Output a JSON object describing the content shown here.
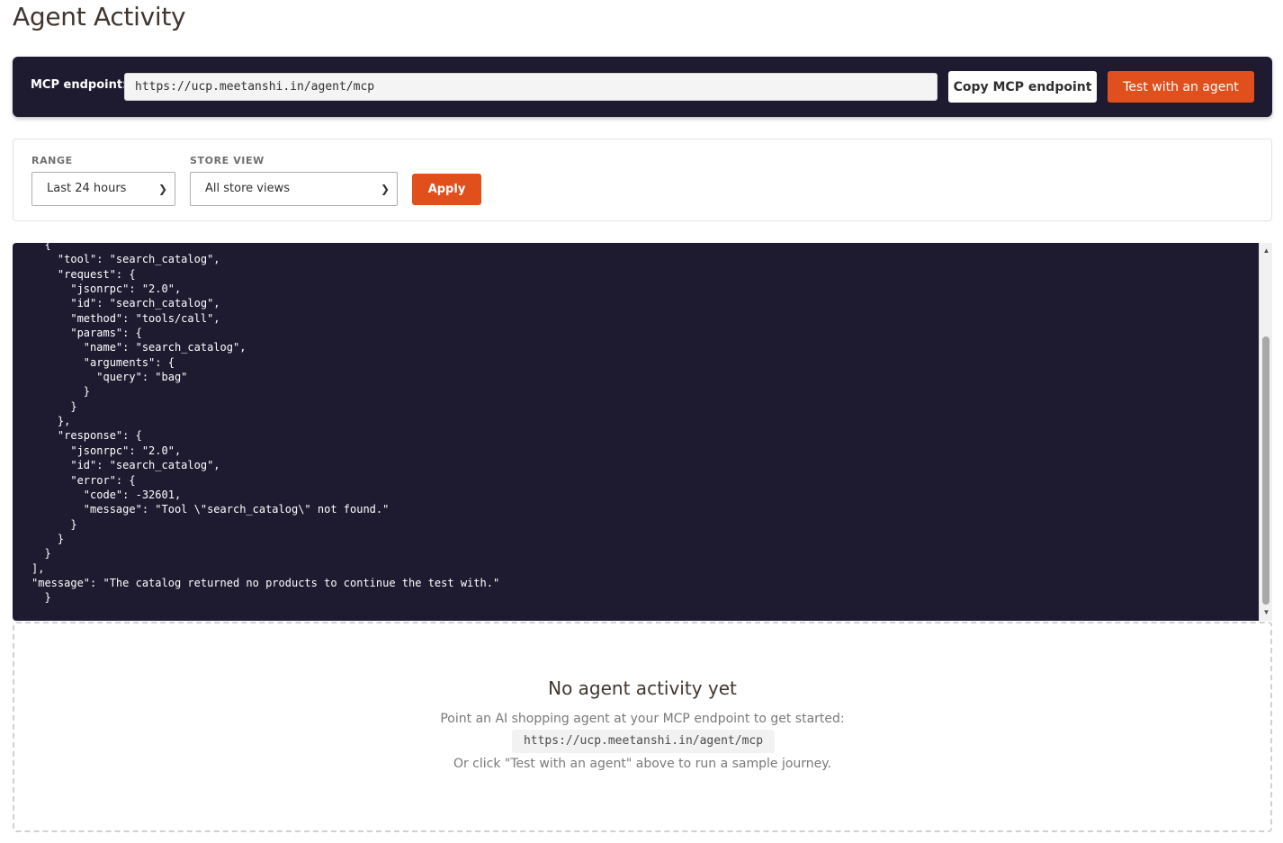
{
  "page": {
    "title": "Agent Activity"
  },
  "endpoint_bar": {
    "label": "MCP endpoint:",
    "url": "https://ucp.meetanshi.in/agent/mcp",
    "copy_label": "Copy MCP endpoint",
    "test_label": "Test with an agent"
  },
  "filters": {
    "range_label": "RANGE",
    "range_value": "Last 24 hours",
    "store_view_label": "STORE VIEW",
    "store_view_value": "All store views",
    "apply_label": "Apply"
  },
  "log": {
    "lines": [
      "      {",
      "        \"tool\": \"search_catalog\",",
      "        \"request\": {",
      "          \"jsonrpc\": \"2.0\",",
      "          \"id\": \"search_catalog\",",
      "          \"method\": \"tools/call\",",
      "          \"params\": {",
      "            \"name\": \"search_catalog\",",
      "            \"arguments\": {",
      "              \"query\": \"bag\"",
      "            }",
      "          }",
      "        },",
      "        \"response\": {",
      "          \"jsonrpc\": \"2.0\",",
      "          \"id\": \"search_catalog\",",
      "          \"error\": {",
      "            \"code\": -32601,",
      "            \"message\": \"Tool \\\"search_catalog\\\" not found.\"",
      "          }",
      "        }",
      "      }",
      "    ],",
      "    \"message\": \"The catalog returned no products to continue the test with.\"",
      "  }"
    ]
  },
  "empty_state": {
    "title": "No agent activity yet",
    "line1": "Point an AI shopping agent at your MCP endpoint to get started:",
    "code": "https://ucp.meetanshi.in/agent/mcp",
    "line3": "Or click \"Test with an agent\" above to run a sample journey."
  },
  "colors": {
    "dark_panel": "#1e1b30",
    "accent": "#e04f1c"
  }
}
